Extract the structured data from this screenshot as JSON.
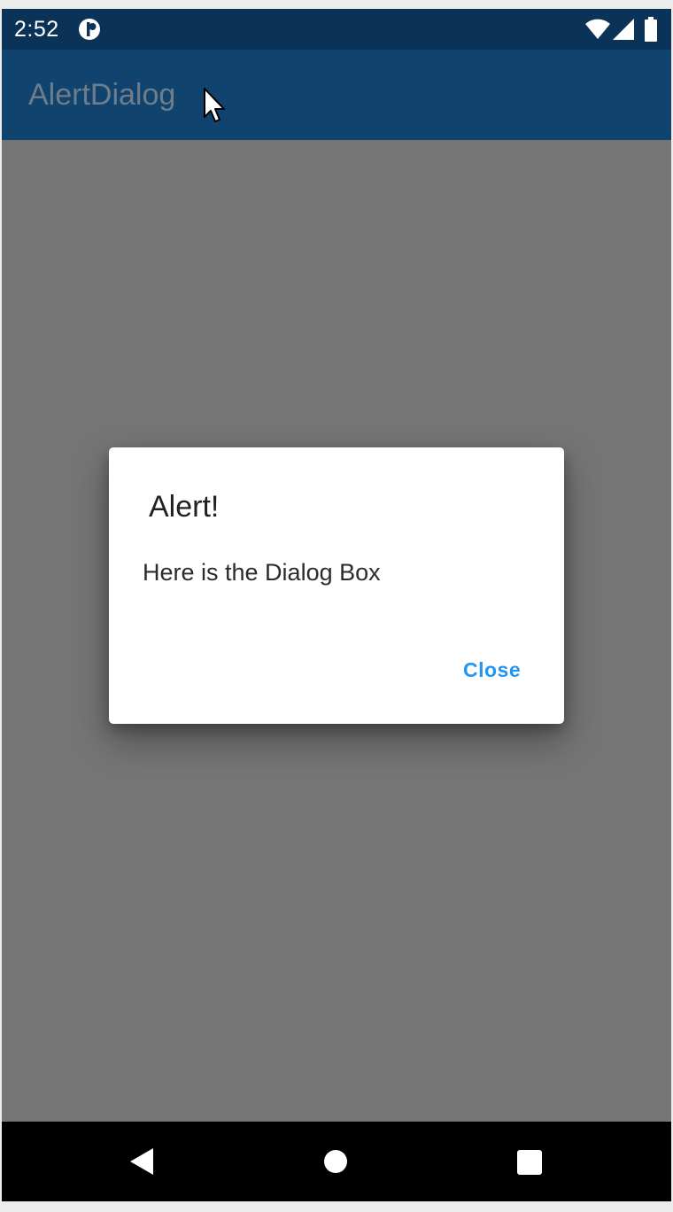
{
  "status_bar": {
    "time": "2:52",
    "icons": [
      "notification-icon",
      "wifi-icon",
      "cell-signal-icon",
      "battery-icon"
    ]
  },
  "app_bar": {
    "title": "AlertDialog"
  },
  "dialog": {
    "title": "Alert!",
    "message": "Here is the Dialog Box",
    "close_label": "Close"
  },
  "nav_bar": {
    "icons": [
      "back-icon",
      "home-icon",
      "recents-icon"
    ]
  },
  "colors": {
    "status_bar": "#0b3358",
    "app_bar": "#10446f",
    "scrim": "#757575",
    "dialog_bg": "#ffffff",
    "accent": "#2196f3",
    "nav_bar": "#000000"
  }
}
